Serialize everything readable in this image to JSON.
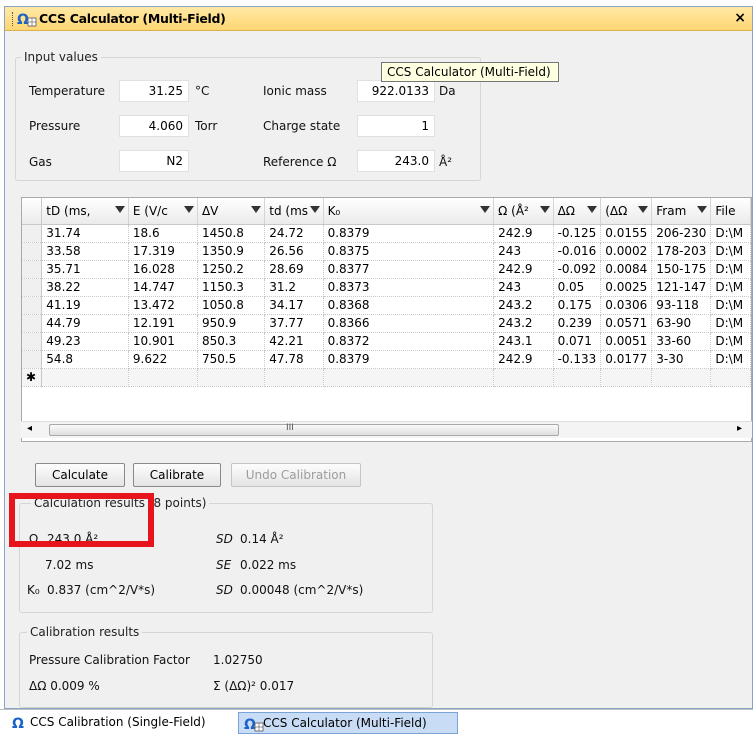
{
  "window": {
    "title": "CCS Calculator (Multi-Field)",
    "close": "×"
  },
  "tooltip": "CCS Calculator (Multi-Field)",
  "input": {
    "legend": "Input values",
    "temperature": {
      "label": "Temperature",
      "value": "31.25",
      "unit": "°C"
    },
    "pressure": {
      "label": "Pressure",
      "value": "4.060",
      "unit": "Torr"
    },
    "gas": {
      "label": "Gas",
      "value": "N2"
    },
    "ionic_mass": {
      "label": "Ionic mass",
      "value": "922.0133",
      "unit": "Da"
    },
    "charge_state": {
      "label": "Charge state",
      "value": "1"
    },
    "reference": {
      "label": "Reference Ω",
      "value": "243.0",
      "unit": "Å²"
    }
  },
  "grid": {
    "columns": [
      "tD (ms,",
      "E (V/c",
      "ΔV",
      "td (ms",
      "K₀",
      "Ω (Å²",
      "ΔΩ",
      "(ΔΩ",
      "Fram",
      "File"
    ],
    "rows": [
      [
        "31.74",
        "18.6",
        "1450.8",
        "24.72",
        "0.8379",
        "242.9",
        "-0.125",
        "0.0155",
        "206-230",
        "D:\\M"
      ],
      [
        "33.58",
        "17.319",
        "1350.9",
        "26.56",
        "0.8375",
        "243",
        "-0.016",
        "0.0002",
        "178-203",
        "D:\\M"
      ],
      [
        "35.71",
        "16.028",
        "1250.2",
        "28.69",
        "0.8377",
        "242.9",
        "-0.092",
        "0.0084",
        "150-175",
        "D:\\M"
      ],
      [
        "38.22",
        "14.747",
        "1150.3",
        "31.2",
        "0.8373",
        "243",
        "0.05",
        "0.0025",
        "121-147",
        "D:\\M"
      ],
      [
        "41.19",
        "13.472",
        "1050.8",
        "34.17",
        "0.8368",
        "243.2",
        "0.175",
        "0.0306",
        "93-118",
        "D:\\M"
      ],
      [
        "44.79",
        "12.191",
        "950.9",
        "37.77",
        "0.8366",
        "243.2",
        "0.239",
        "0.0571",
        "63-90",
        "D:\\M"
      ],
      [
        "49.23",
        "10.901",
        "850.3",
        "42.21",
        "0.8372",
        "243.1",
        "0.071",
        "0.0051",
        "33-60",
        "D:\\M"
      ],
      [
        "54.8",
        "9.622",
        "750.5",
        "47.78",
        "0.8379",
        "242.9",
        "-0.133",
        "0.0177",
        "3-30",
        "D:\\M"
      ]
    ],
    "new_row_marker": "✱",
    "scroll_mid": "III"
  },
  "buttons": {
    "calculate": "Calculate",
    "calibrate": "Calibrate",
    "undo": "Undo Calibration"
  },
  "calc_results": {
    "legend": "Calculation results (8 points)",
    "omega_sym": "Ω",
    "omega_val": "243.0 Å²",
    "sd1_lbl": "SD",
    "sd1_val": "0.14 Å²",
    "t0_val": "7.02 ms",
    "se_lbl": "SE",
    "se_val": "0.022 ms",
    "k0_sym": "K₀",
    "k0_val": "0.837 (cm^2/V*s)",
    "sd2_lbl": "SD",
    "sd2_val": "0.00048 (cm^2/V*s)"
  },
  "calib_results": {
    "legend": "Calibration results",
    "factor_label": "Pressure Calibration Factor",
    "factor_val": "1.02750",
    "dOmega": "ΔΩ 0.009 %",
    "sum": "Σ (ΔΩ)² 0.017"
  },
  "tabs": [
    {
      "label": "CCS Calibration (Single-Field)"
    },
    {
      "label": "CCS Calculator (Multi-Field)"
    }
  ]
}
